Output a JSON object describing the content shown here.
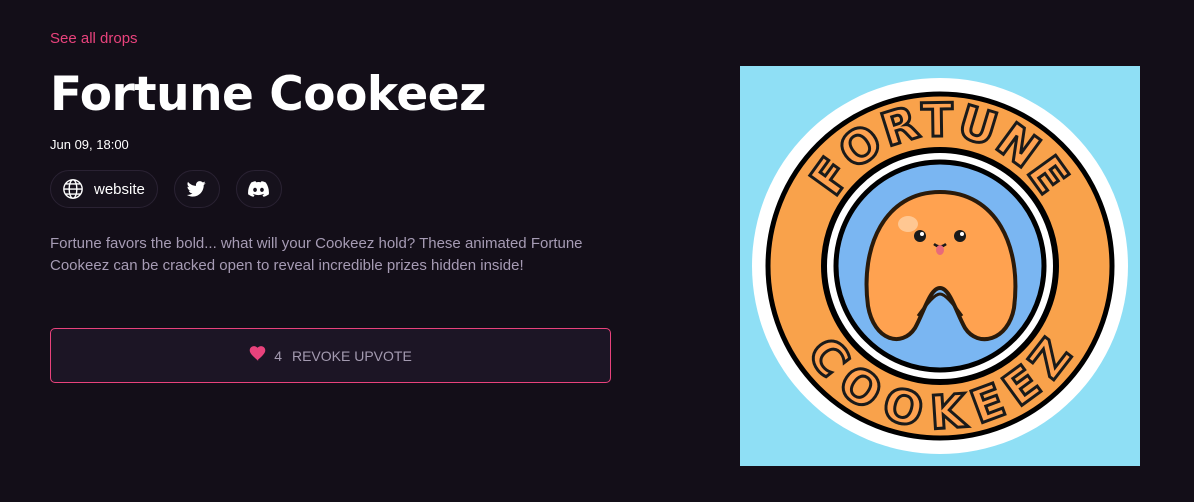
{
  "nav": {
    "back_label": "See all drops"
  },
  "drop": {
    "title": "Fortune Cookeez",
    "date": "Jun 09, 18:00",
    "description": "Fortune favors the bold... what will your Cookeez hold? These animated Fortune Cookeez can be cracked open to reveal incredible prizes hidden inside!"
  },
  "links": {
    "website_label": "website",
    "website_icon": "globe-icon",
    "twitter_icon": "twitter-icon",
    "discord_icon": "discord-icon"
  },
  "upvote": {
    "count": "4",
    "label": "REVOKE UPVOTE",
    "icon": "heart-icon"
  },
  "artwork": {
    "top_text": "FORTUNE",
    "bottom_text": "COOKEEZ"
  },
  "colors": {
    "background": "#130e18",
    "accent": "#e8427c",
    "artwork_background": "#8fdff5",
    "logo_orange": "#f9a24b"
  }
}
